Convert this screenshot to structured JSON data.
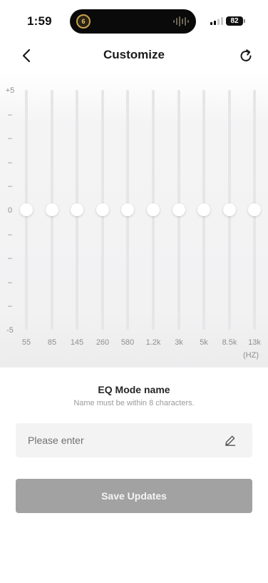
{
  "status_bar": {
    "time": "1:59",
    "island_badge": "6",
    "battery": "82"
  },
  "header": {
    "title": "Customize",
    "back_icon": "chevron-left-icon",
    "refresh_icon": "refresh-icon"
  },
  "equalizer": {
    "db_scale": [
      "+5",
      "–",
      "–",
      "–",
      "–",
      "0",
      "–",
      "–",
      "–",
      "–",
      "-5"
    ],
    "bands": [
      {
        "freq": "55",
        "gain": 0
      },
      {
        "freq": "85",
        "gain": 0
      },
      {
        "freq": "145",
        "gain": 0
      },
      {
        "freq": "260",
        "gain": 0
      },
      {
        "freq": "580",
        "gain": 0
      },
      {
        "freq": "1.2k",
        "gain": 0
      },
      {
        "freq": "3k",
        "gain": 0
      },
      {
        "freq": "5k",
        "gain": 0
      },
      {
        "freq": "8.5k",
        "gain": 0
      },
      {
        "freq": "13k",
        "gain": 0
      }
    ],
    "gain_range": [
      -5,
      5
    ],
    "unit": "(HZ)"
  },
  "mode_name": {
    "title": "EQ Mode name",
    "hint": "Name must be within 8 characters.",
    "placeholder": "Please enter",
    "value": "",
    "edit_icon": "pencil-icon"
  },
  "actions": {
    "save_label": "Save Updates"
  },
  "colors": {
    "save_button_bg": "#a2a2a2",
    "track": "#e6e6e8",
    "knob": "#ffffff"
  }
}
